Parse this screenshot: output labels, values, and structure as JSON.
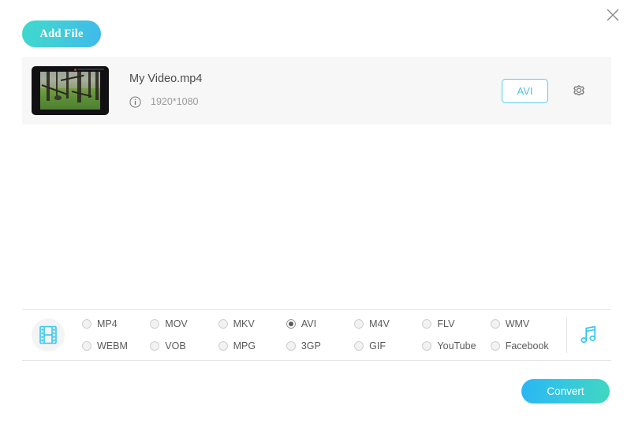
{
  "window": {
    "close_label": "×"
  },
  "toolbar": {
    "add_file_label": "Add File"
  },
  "file_list": [
    {
      "name": "My Video.mp4",
      "resolution": "1920*1080",
      "output_format": "AVI"
    }
  ],
  "format_bar": {
    "video_options": [
      {
        "label": "MP4",
        "selected": false
      },
      {
        "label": "MOV",
        "selected": false
      },
      {
        "label": "MKV",
        "selected": false
      },
      {
        "label": "AVI",
        "selected": true
      },
      {
        "label": "M4V",
        "selected": false
      },
      {
        "label": "FLV",
        "selected": false
      },
      {
        "label": "WMV",
        "selected": false
      },
      {
        "label": "WEBM",
        "selected": false
      },
      {
        "label": "VOB",
        "selected": false
      },
      {
        "label": "MPG",
        "selected": false
      },
      {
        "label": "3GP",
        "selected": false
      },
      {
        "label": "GIF",
        "selected": false
      },
      {
        "label": "YouTube",
        "selected": false
      },
      {
        "label": "Facebook",
        "selected": false
      }
    ]
  },
  "actions": {
    "convert_label": "Convert"
  },
  "icons": {
    "close": "close-icon",
    "info": "info-circle-icon",
    "settings": "gear-icon",
    "video": "film-strip-icon",
    "audio": "music-note-icon"
  },
  "colors": {
    "accent_cyan": "#4fc3e8",
    "gradient_teal": "#3ed8cd",
    "gradient_blue": "#2ab6f4",
    "row_background": "#f7f7f7",
    "border": "#e6e6e6"
  }
}
